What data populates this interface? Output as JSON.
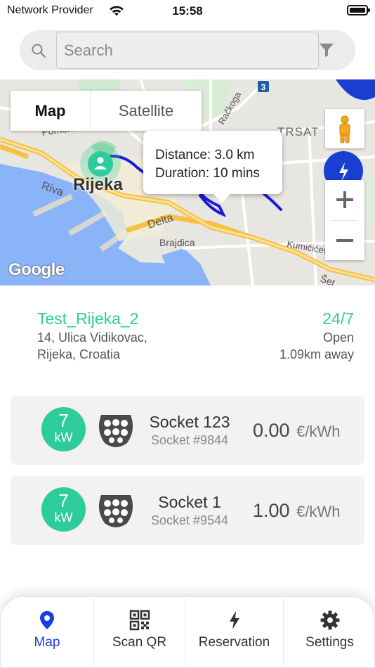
{
  "status_bar": {
    "carrier": "Network Provider",
    "time": "15:58"
  },
  "search": {
    "placeholder": "Search",
    "icon": "search-icon",
    "filter_icon": "filter-icon"
  },
  "map": {
    "type_control": {
      "map_label": "Map",
      "satellite_label": "Satellite",
      "selected": "Map"
    },
    "info_window": {
      "distance": "Distance: 3.0 km",
      "duration": "Duration: 10 mins"
    },
    "city_label": "Rijeka",
    "street_labels": [
      "Pomerio",
      "Riva",
      "Delta",
      "Brajdica",
      "Kumičićeva ul.",
      "Šet",
      "TRSAT",
      "Račkoga"
    ],
    "route_badge": "3",
    "attribution": "Google",
    "route_color": "#1a1ad8",
    "marker_color": "#2ecc9a"
  },
  "station": {
    "name": "Test_Rijeka_2",
    "address_line1": "14, Ulica Vidikovac,",
    "address_line2": "Rijeka, Croatia",
    "hours": "24/7",
    "status": "Open",
    "distance": "1.09km away",
    "accent_color": "#2ecc9a"
  },
  "sockets": [
    {
      "power": "7",
      "power_unit": "kW",
      "name": "Socket 123",
      "number": "Socket #9844",
      "price": "0.00",
      "price_unit": "€/kWh"
    },
    {
      "power": "7",
      "power_unit": "kW",
      "name": "Socket 1",
      "number": "Socket #9544",
      "price": "1.00",
      "price_unit": "€/kWh"
    }
  ],
  "tabs": [
    {
      "label": "Map",
      "icon": "map-pin-icon",
      "active": true
    },
    {
      "label": "Scan QR",
      "icon": "qr-code-icon",
      "active": false
    },
    {
      "label": "Reservation",
      "icon": "lightning-icon",
      "active": false
    },
    {
      "label": "Settings",
      "icon": "gear-icon",
      "active": false
    }
  ],
  "colors": {
    "active_tab": "#1a3fe0",
    "accent": "#2ecc9a"
  }
}
